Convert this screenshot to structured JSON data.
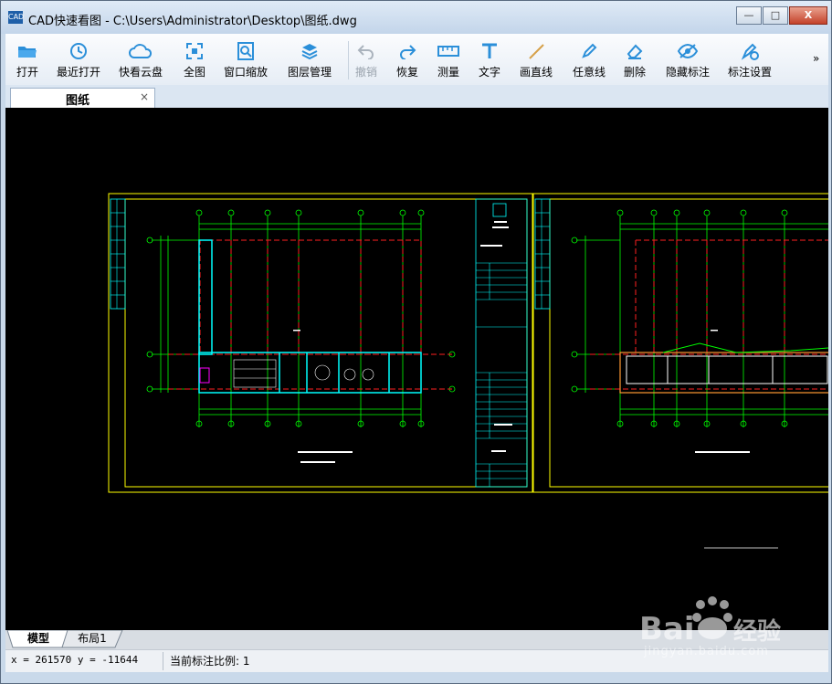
{
  "window": {
    "title": "CAD快速看图 - C:\\Users\\Administrator\\Desktop\\图纸.dwg",
    "app_icon_text": "CAD",
    "buttons": {
      "minimize": "—",
      "maximize": "□",
      "close": "X"
    }
  },
  "toolbar": {
    "items": [
      {
        "label": "打开",
        "icon": "folder-open-icon"
      },
      {
        "label": "最近打开",
        "icon": "clock-icon"
      },
      {
        "label": "快看云盘",
        "icon": "cloud-icon"
      },
      {
        "label": "全图",
        "icon": "fit-screen-icon"
      },
      {
        "label": "窗口缩放",
        "icon": "zoom-window-icon"
      },
      {
        "label": "图层管理",
        "icon": "layers-icon"
      },
      {
        "label": "撤销",
        "icon": "undo-icon",
        "disabled": true
      },
      {
        "label": "恢复",
        "icon": "redo-icon"
      },
      {
        "label": "测量",
        "icon": "ruler-icon"
      },
      {
        "label": "文字",
        "icon": "text-icon"
      },
      {
        "label": "画直线",
        "icon": "line-icon"
      },
      {
        "label": "任意线",
        "icon": "pen-icon"
      },
      {
        "label": "删除",
        "icon": "eraser-icon"
      },
      {
        "label": "隐藏标注",
        "icon": "eye-hidden-icon"
      },
      {
        "label": "标注设置",
        "icon": "annotation-settings-icon"
      }
    ],
    "more": "»"
  },
  "document_tab": {
    "label": "图纸",
    "close": "×"
  },
  "layout_tabs": [
    "模型",
    "布局1"
  ],
  "status": {
    "coords": "x = 261570  y = -11644",
    "scale": "当前标注比例: 1"
  },
  "watermark": {
    "brand": "Bai du 经验",
    "url": "jingyan.baidu.com"
  },
  "colors": {
    "canvas": "#000000",
    "frame": "#ffff00",
    "axis": "#00ff00",
    "grid_red": "#ff2020",
    "wall": "#00ffff",
    "white": "#ffffff"
  }
}
